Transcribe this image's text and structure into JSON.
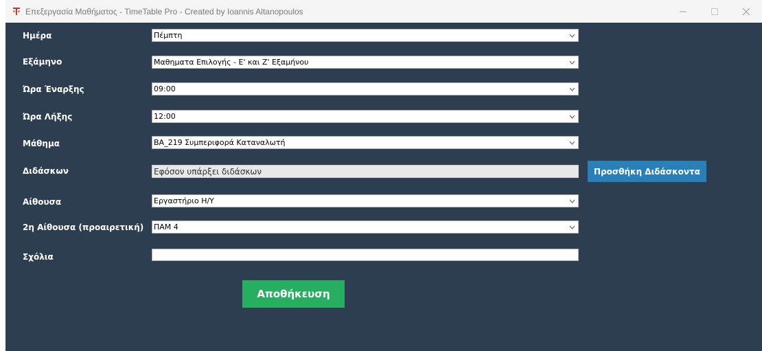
{
  "window": {
    "title": "Επεξεργασία Μαθήματος - TimeTable Pro - Created by Ioannis Altanopoulos",
    "controls": {
      "minimize": "—",
      "maximize": "☐",
      "close": "✕"
    }
  },
  "form": {
    "day": {
      "label": "Ημέρα",
      "value": "Πέμπτη"
    },
    "semester": {
      "label": "Εξάμηνο",
      "value": "Μαθηματα Επιλογής - Ε' και Ζ' Εξαμήνου"
    },
    "start_time": {
      "label": "Ώρα Έναρξης",
      "value": "09:00"
    },
    "end_time": {
      "label": "Ώρα Λήξης",
      "value": "12:00"
    },
    "course": {
      "label": "Μάθημα",
      "value": "BA_219 Συμπεριφορά Καταναλωτή"
    },
    "instructor": {
      "label": "Διδάσκων",
      "value": "Εφόσον υπάρξει διδάσκων"
    },
    "room": {
      "label": "Αίθουσα",
      "value": "Εργαστήριο Η/Υ"
    },
    "room2": {
      "label": "2η Αίθουσα (προαιρετική)",
      "value": "ΠΑΜ 4"
    },
    "comments": {
      "label": "Σχόλια",
      "value": ""
    }
  },
  "buttons": {
    "add_instructor": "Προσθήκη Διδάσκοντα",
    "save": "Αποθήκευση"
  },
  "colors": {
    "background": "#2c3e50",
    "add_button": "#2980b9",
    "save_button": "#27ae60",
    "app_icon": "#c0392b"
  }
}
